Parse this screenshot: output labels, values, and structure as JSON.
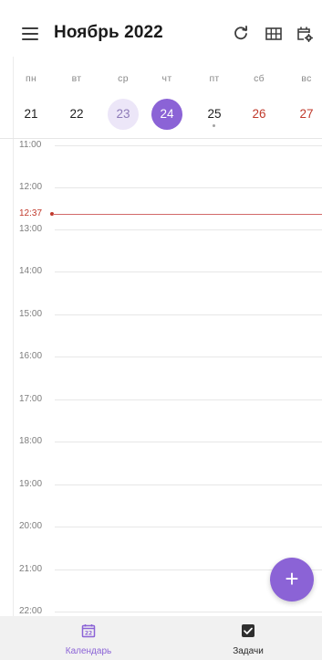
{
  "header": {
    "title": "Ноябрь 2022",
    "icons": [
      "menu-icon",
      "refresh-icon",
      "grid-view-icon",
      "calendar-settings-icon"
    ]
  },
  "week": {
    "days": [
      {
        "label": "пн",
        "date": "21",
        "weekend": false
      },
      {
        "label": "вт",
        "date": "22",
        "weekend": false
      },
      {
        "label": "ср",
        "date": "23",
        "weekend": false,
        "selected": true
      },
      {
        "label": "чт",
        "date": "24",
        "weekend": false,
        "today": true
      },
      {
        "label": "пт",
        "date": "25",
        "weekend": false,
        "has_event": true
      },
      {
        "label": "сб",
        "date": "26",
        "weekend": true
      },
      {
        "label": "вс",
        "date": "27",
        "weekend": true
      }
    ]
  },
  "timeline": {
    "hours": [
      "11:00",
      "12:00",
      "13:00",
      "14:00",
      "15:00",
      "16:00",
      "17:00",
      "18:00",
      "19:00",
      "20:00",
      "21:00",
      "22:00"
    ],
    "current_time": "12:37"
  },
  "fab": {
    "label": "+"
  },
  "bottom_nav": {
    "calendar_label": "Календарь",
    "calendar_icon_day": "22",
    "tasks_label": "Задачи"
  },
  "colors": {
    "accent": "#8b63d6",
    "selected_bg": "#ece6f8",
    "weekend": "#c0392b",
    "now_line": "#d26a6a"
  }
}
